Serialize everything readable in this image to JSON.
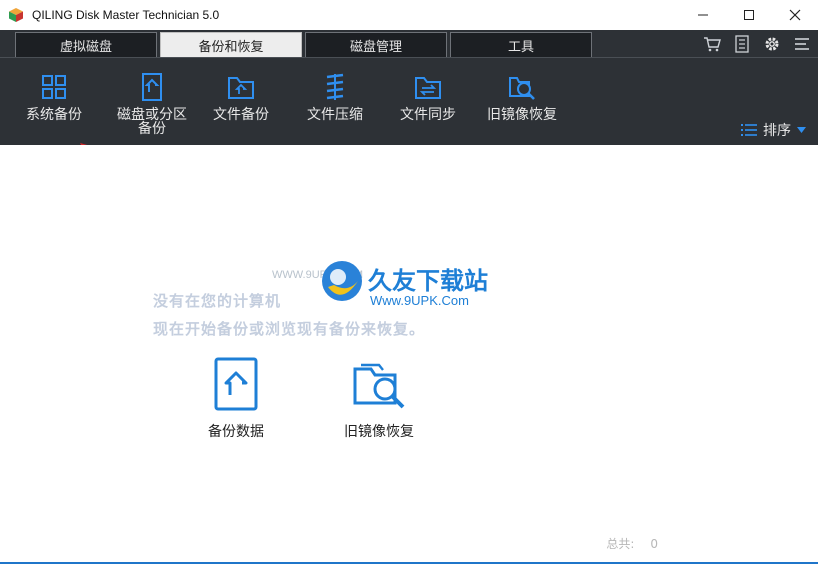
{
  "window": {
    "title": "QILING Disk Master Technician 5.0",
    "minimize": "—",
    "maximize": "☐",
    "close": "✕"
  },
  "tabs": [
    {
      "label": "虚拟磁盘",
      "active": false
    },
    {
      "label": "备份和恢复",
      "active": true
    },
    {
      "label": "磁盘管理",
      "active": false
    },
    {
      "label": "工具",
      "active": false
    }
  ],
  "tab_tools": [
    "cart-icon",
    "document-list-icon",
    "gear-icon",
    "menu-icon"
  ],
  "toolbar": {
    "items": [
      {
        "label": "系统备份",
        "icon": "system-backup-icon"
      },
      {
        "label": "磁盘或分区备份",
        "icon": "disk-partition-backup-icon"
      },
      {
        "label": "文件备份",
        "icon": "file-backup-icon"
      },
      {
        "label": "文件压缩",
        "icon": "file-compress-icon"
      },
      {
        "label": "文件同步",
        "icon": "file-sync-icon"
      },
      {
        "label": "旧镜像恢复",
        "icon": "old-image-restore-icon"
      }
    ],
    "sort_label": "排序"
  },
  "main": {
    "empty_line1": "没有在您的计算机",
    "empty_line2": "现在开始备份或浏览现有备份来恢复。",
    "actions": [
      {
        "label": "备份数据",
        "icon": "backup-data-icon"
      },
      {
        "label": "旧镜像恢复",
        "icon": "old-image-restore-icon"
      }
    ],
    "total_label": "总共:",
    "total_value": "0"
  },
  "watermark": {
    "title": "久友下载站",
    "url": "Www.9UPK.Com",
    "small": "WWW.9UPK.COM"
  },
  "colors": {
    "accent": "#1e7fd6",
    "toolbar_bg": "#2d3136",
    "arrow": "#d6262a"
  }
}
